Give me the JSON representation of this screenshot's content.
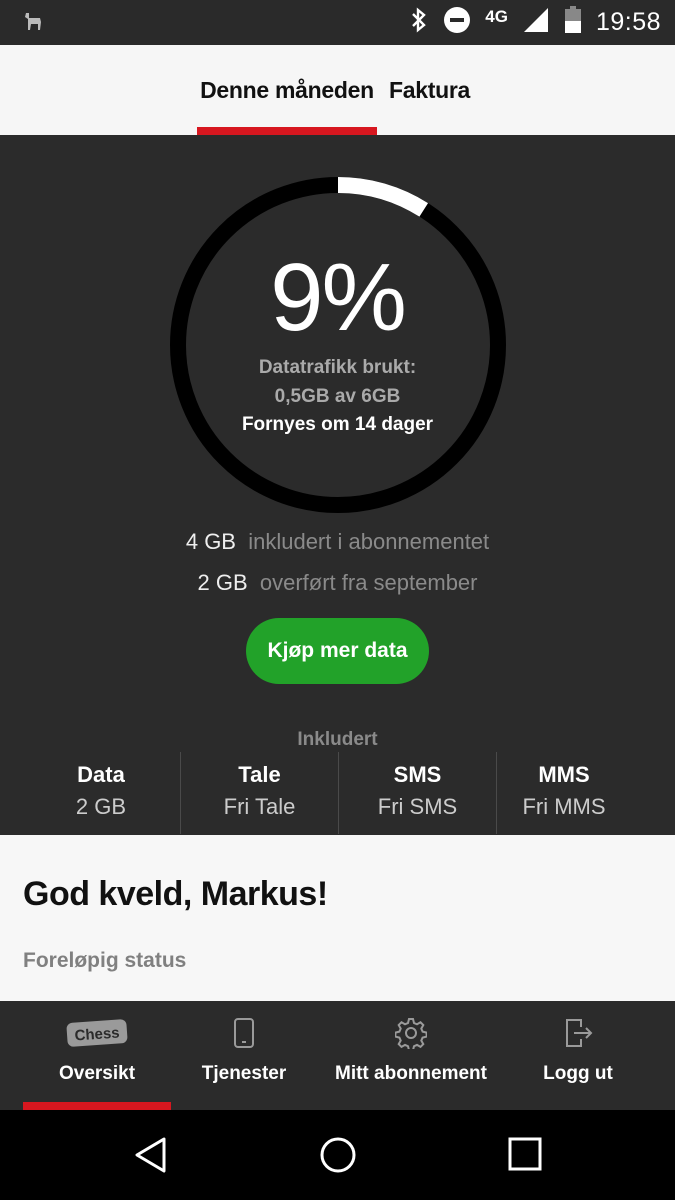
{
  "status_bar": {
    "network": "4G",
    "time": "19:58"
  },
  "tabs": [
    {
      "label": "Denne måneden",
      "active": true
    },
    {
      "label": "Faktura",
      "active": false
    }
  ],
  "usage": {
    "percent_text": "9%",
    "used_fraction": 0.09,
    "used_label": "Datatrafikk brukt:",
    "used_amount": "0,5GB av 6GB",
    "renews": "Fornyes om 14 dager",
    "allocations": [
      {
        "amount": "4 GB",
        "description": "inkludert i abonnementet"
      },
      {
        "amount": "2 GB",
        "description": "overført fra september"
      }
    ],
    "buy_button": "Kjøp mer data"
  },
  "included": {
    "title": "Inkludert",
    "columns": [
      {
        "heading": "Data",
        "value": "2 GB"
      },
      {
        "heading": "Tale",
        "value": "Fri Tale"
      },
      {
        "heading": "SMS",
        "value": "Fri SMS"
      },
      {
        "heading": "MMS",
        "value": "Fri MMS"
      }
    ]
  },
  "greeting": {
    "title": "God kveld, Markus!",
    "subtitle": "Foreløpig status"
  },
  "bottom_nav": [
    {
      "label": "Oversikt",
      "icon": "chess-logo-icon",
      "active": true
    },
    {
      "label": "Tjenester",
      "icon": "phone-icon",
      "active": false
    },
    {
      "label": "Mitt abonnement",
      "icon": "gear-icon",
      "active": false
    },
    {
      "label": "Logg ut",
      "icon": "logout-icon",
      "active": false
    }
  ],
  "colors": {
    "accent_red": "#d7171f",
    "buy_green": "#22a229",
    "panel_dark": "#2b2b2b"
  }
}
